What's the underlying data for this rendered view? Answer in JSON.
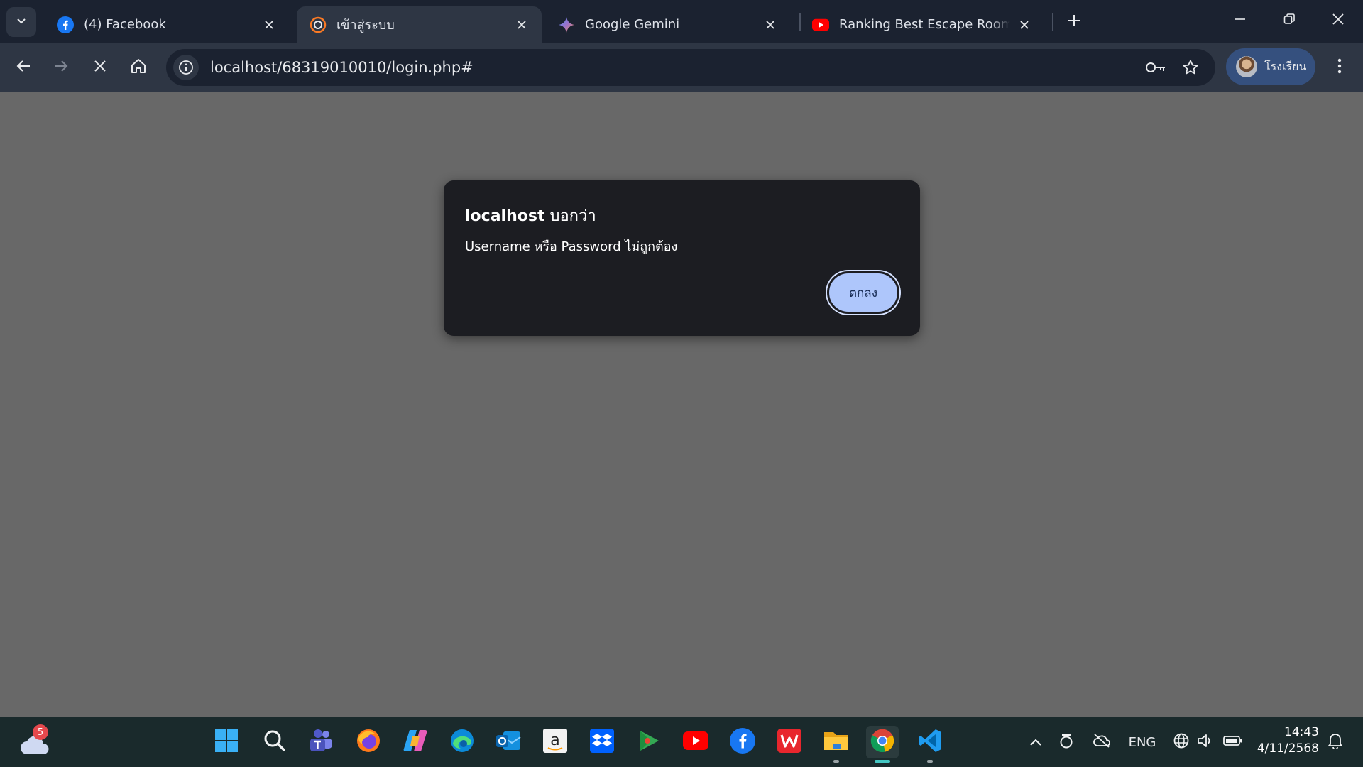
{
  "tabs": [
    {
      "title": "(4) Facebook",
      "favicon": "facebook-icon",
      "active": false
    },
    {
      "title": "เข้าสู่ระบบ",
      "favicon": "xampp-icon",
      "active": true
    },
    {
      "title": "Google Gemini",
      "favicon": "gemini-icon",
      "active": false
    },
    {
      "title": "Ranking Best Escape Room Mo",
      "favicon": "youtube-icon",
      "active": false
    }
  ],
  "toolbar": {
    "url": "localhost/68319010010/login.php#",
    "profile_name": "โรงเรียน"
  },
  "dialog": {
    "host": "localhost",
    "says": "บอกว่า",
    "message": "Username หรือ Password ไม่ถูกต้อง",
    "ok_label": "ตกลง"
  },
  "taskbar": {
    "weather_badge": "5",
    "apps": [
      "start-icon",
      "search-icon",
      "teams-icon",
      "firefox-icon",
      "copilot-icon",
      "edge-icon",
      "outlook-icon",
      "amazon-icon",
      "dropbox-icon",
      "google-play-games-icon",
      "youtube-icon",
      "facebook-icon",
      "wps-office-icon",
      "file-explorer-icon",
      "chrome-icon",
      "vscode-icon"
    ],
    "tray": {
      "language": "ENG"
    },
    "clock": {
      "time": "14:43",
      "date": "4/11/2568"
    }
  },
  "colors": {
    "tabstrip": "#1b2230",
    "toolbar": "#2e3644",
    "page_overlay": "#686868",
    "dialog_bg": "#1c1d22",
    "ok_button": "#aec6fb",
    "taskbar": "#1a2a2c"
  }
}
